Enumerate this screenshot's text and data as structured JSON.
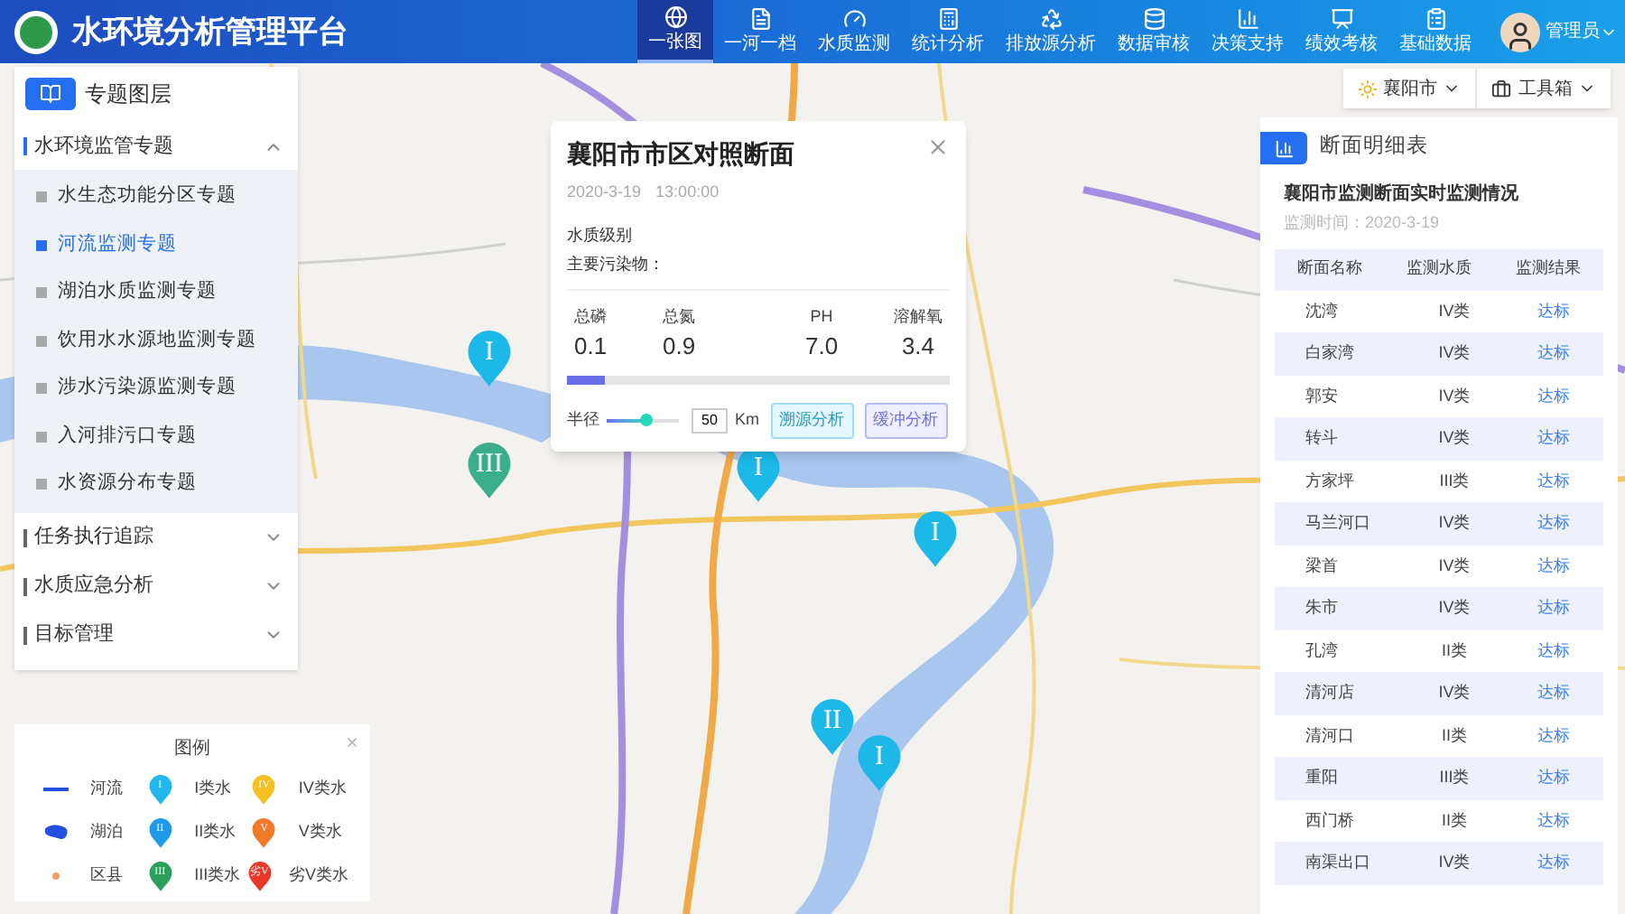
{
  "header": {
    "title": "水环境分析管理平台",
    "nav": [
      {
        "label": "一张图",
        "selected": true
      },
      {
        "label": "一河一档",
        "selected": false
      },
      {
        "label": "水质监测",
        "selected": false
      },
      {
        "label": "统计分析",
        "selected": false
      },
      {
        "label": "排放源分析",
        "selected": false
      },
      {
        "label": "数据审核",
        "selected": false
      },
      {
        "label": "决策支持",
        "selected": false
      },
      {
        "label": "绩效考核",
        "selected": false
      },
      {
        "label": "基础数据",
        "selected": false
      }
    ],
    "user": "管理员"
  },
  "sidebar": {
    "title": "专题图层",
    "groups": [
      {
        "label": "水环境监管专题",
        "expanded": true,
        "children": [
          {
            "label": "水生态功能分区专题",
            "selected": false
          },
          {
            "label": "河流监测专题",
            "selected": true
          },
          {
            "label": "湖泊水质监测专题",
            "selected": false
          },
          {
            "label": "饮用水水源地监测专题",
            "selected": false
          },
          {
            "label": "涉水污染源监测专题",
            "selected": false
          },
          {
            "label": "入河排污口专题",
            "selected": false
          },
          {
            "label": "水资源分布专题",
            "selected": false
          }
        ]
      },
      {
        "label": "任务执行追踪",
        "expanded": false
      },
      {
        "label": "水质应急分析",
        "expanded": false
      },
      {
        "label": "目标管理",
        "expanded": false
      }
    ]
  },
  "map_controls": {
    "city": "襄阳市",
    "toolbox": "工具箱"
  },
  "markers": [
    {
      "label": "I",
      "color": "#1cb8e8"
    },
    {
      "label": "III",
      "color": "#3aae8a"
    },
    {
      "label": "I",
      "color": "#1cb8e8"
    },
    {
      "label": "I",
      "color": "#1cb8e8"
    },
    {
      "label": "II",
      "color": "#1cb8e8"
    },
    {
      "label": "I",
      "color": "#1cb8e8"
    }
  ],
  "popup": {
    "title": "襄阳市市区对照断面",
    "date": "2020-3-19",
    "time": "13:00:00",
    "fields": [
      "水质级别",
      "主要污染物："
    ],
    "metrics": [
      {
        "name": "总磷",
        "value": "0.1"
      },
      {
        "name": "总氮",
        "value": "0.9"
      },
      {
        "name": "PH",
        "value": "7.0"
      },
      {
        "name": "溶解氧",
        "value": "3.4"
      }
    ],
    "progress": {
      "level": 0.1
    },
    "radius": {
      "label": "半径",
      "level": 0.55,
      "value": "50",
      "unit": "Km"
    },
    "buttons": [
      {
        "label": "溯源分析",
        "kind": "trace"
      },
      {
        "label": "缓冲分析",
        "kind": "buffer"
      }
    ]
  },
  "detail": {
    "title": "断面明细表",
    "subtitle": "襄阳市监测断面实时监测情况",
    "time": "监测时间：2020-3-19",
    "columns": [
      "断面名称",
      "监测水质",
      "监测结果"
    ],
    "rows": [
      {
        "name": "沈湾",
        "quality": "IV类",
        "result": "达标"
      },
      {
        "name": "白家湾",
        "quality": "IV类",
        "result": "达标"
      },
      {
        "name": "郭安",
        "quality": "IV类",
        "result": "达标"
      },
      {
        "name": "转斗",
        "quality": "IV类",
        "result": "达标"
      },
      {
        "name": "方家坪",
        "quality": "III类",
        "result": "达标"
      },
      {
        "name": "马兰河口",
        "quality": "IV类",
        "result": "达标"
      },
      {
        "name": "梁首",
        "quality": "IV类",
        "result": "达标"
      },
      {
        "name": "朱市",
        "quality": "IV类",
        "result": "达标"
      },
      {
        "name": "孔湾",
        "quality": "II类",
        "result": "达标"
      },
      {
        "name": "清河店",
        "quality": "IV类",
        "result": "达标"
      },
      {
        "name": "清河口",
        "quality": "II类",
        "result": "达标"
      },
      {
        "name": "重阳",
        "quality": "III类",
        "result": "达标"
      },
      {
        "name": "西门桥",
        "quality": "II类",
        "result": "达标"
      },
      {
        "name": "南渠出口",
        "quality": "IV类",
        "result": "达标"
      }
    ]
  },
  "legend": {
    "title": "图例",
    "items": [
      {
        "kind": "line",
        "label": "河流"
      },
      {
        "kind": "marker",
        "glyph": "I",
        "label": "I类水",
        "color": "#22b8ee"
      },
      {
        "kind": "marker",
        "glyph": "IV",
        "label": "IV类水",
        "color": "#f5c021"
      },
      {
        "kind": "lake",
        "label": "湖泊"
      },
      {
        "kind": "marker",
        "glyph": "II",
        "label": "II类水",
        "color": "#1e9be8"
      },
      {
        "kind": "marker",
        "glyph": "V",
        "label": "V类水",
        "color": "#f07a2a"
      },
      {
        "kind": "dot",
        "label": "区县"
      },
      {
        "kind": "marker",
        "glyph": "III",
        "label": "III类水",
        "color": "#2aa05a"
      },
      {
        "kind": "marker",
        "glyph": "劣V",
        "label": "劣V类水",
        "color": "#e8382a"
      }
    ]
  }
}
